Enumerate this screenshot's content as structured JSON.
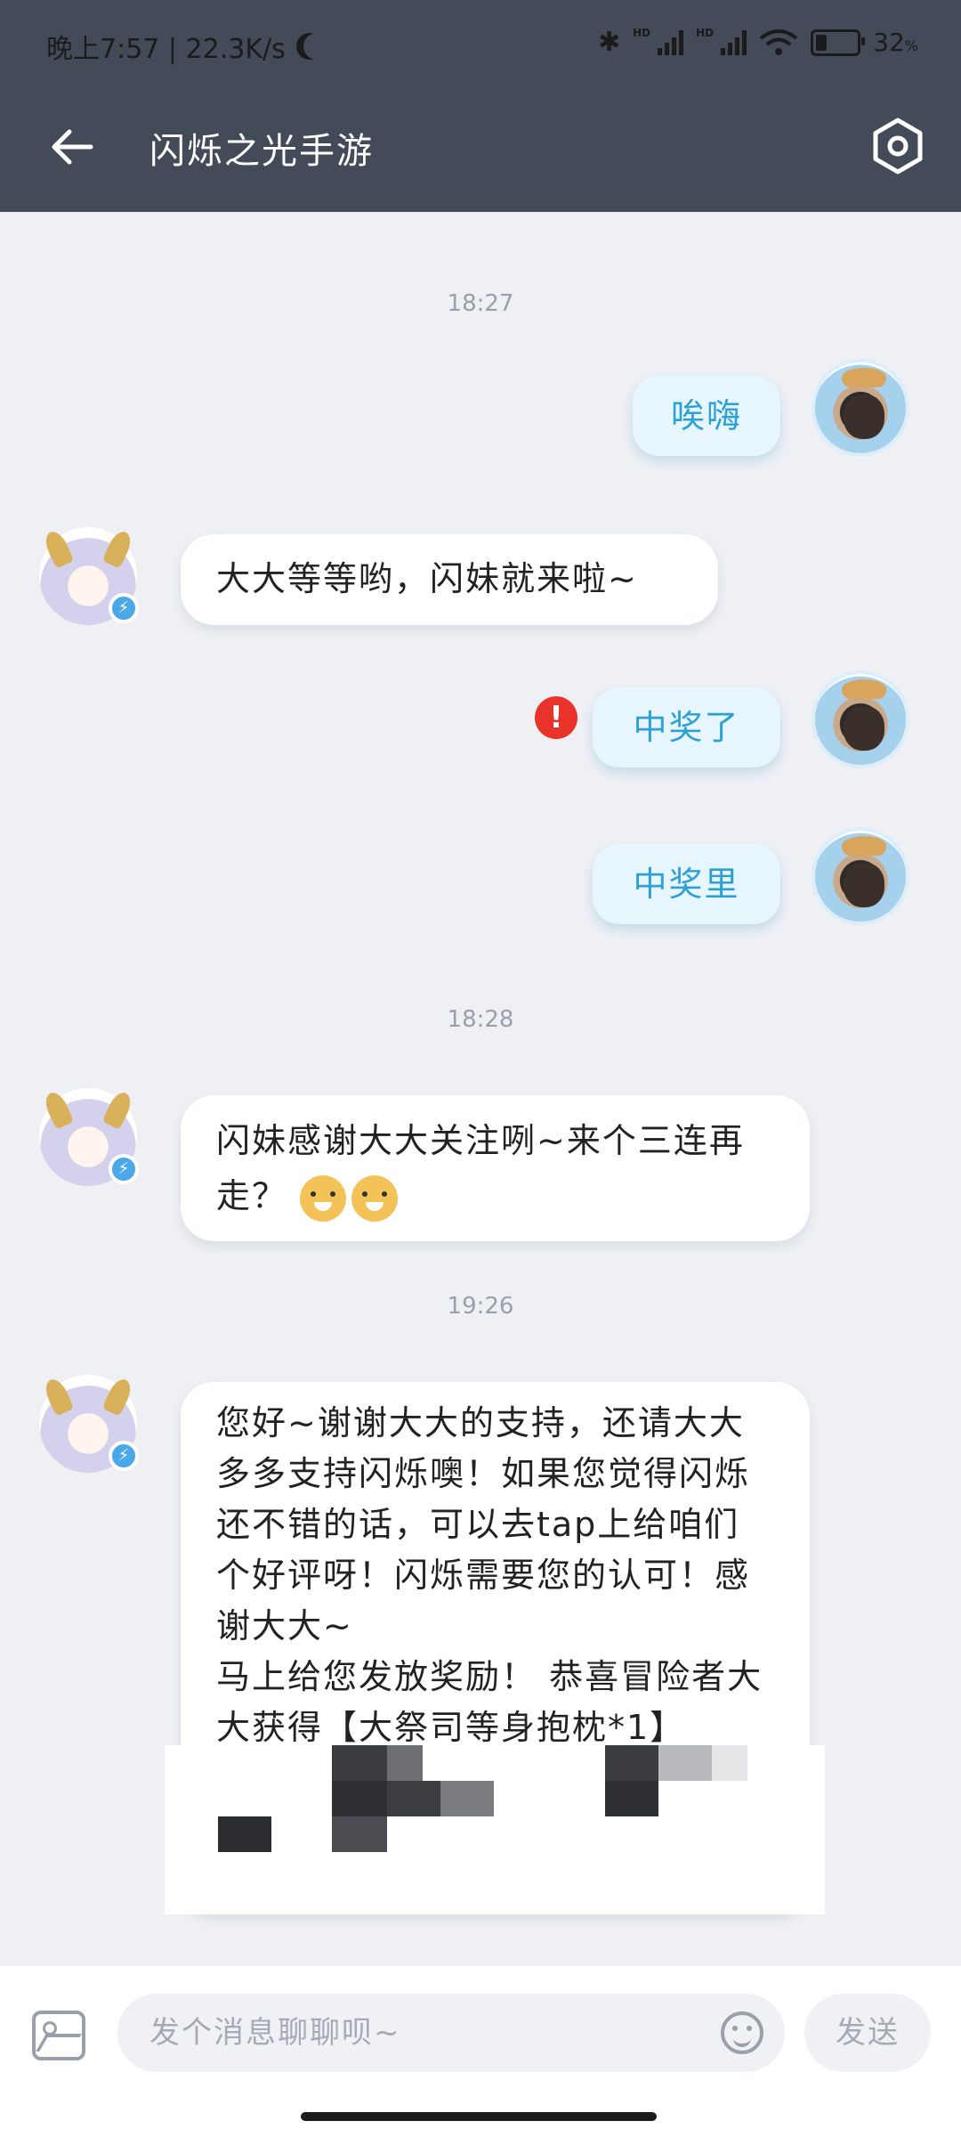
{
  "status_bar": {
    "time_speed": "晚上7:57 | 22.3K/s",
    "battery": "32",
    "battery_unit": "%",
    "battery_level": 0.32,
    "hd_label": "HD"
  },
  "header": {
    "title": "闪烁之光手游",
    "back_icon": "arrow-left-icon",
    "settings_icon": "hexagon-settings-icon"
  },
  "chat": {
    "time_1": "18:27",
    "msg_user_1": "唉嗨",
    "msg_bot_1": "大大等等哟，闪妹就来啦~",
    "msg_user_2": "中奖了",
    "error_mark": "!",
    "msg_user_3": "中奖里",
    "time_2": "18:28",
    "msg_bot_2": "闪妹感谢大大关注咧~来个三连再走？",
    "time_3": "19:26",
    "msg_bot_3_line1": "您好~谢谢大大的支持，还请大大多多支持闪烁噢！如果您觉得闪烁还不错的话，可以去tap上给咱们个好评呀！闪烁需要您的认可！感谢大大~",
    "msg_bot_3_line2": "马上给您发放奖励！ 恭喜冒险者大大获得【大祭司等身抱枕*1】"
  },
  "input_bar": {
    "placeholder": "发个消息聊聊呗~",
    "send_label": "发送"
  }
}
